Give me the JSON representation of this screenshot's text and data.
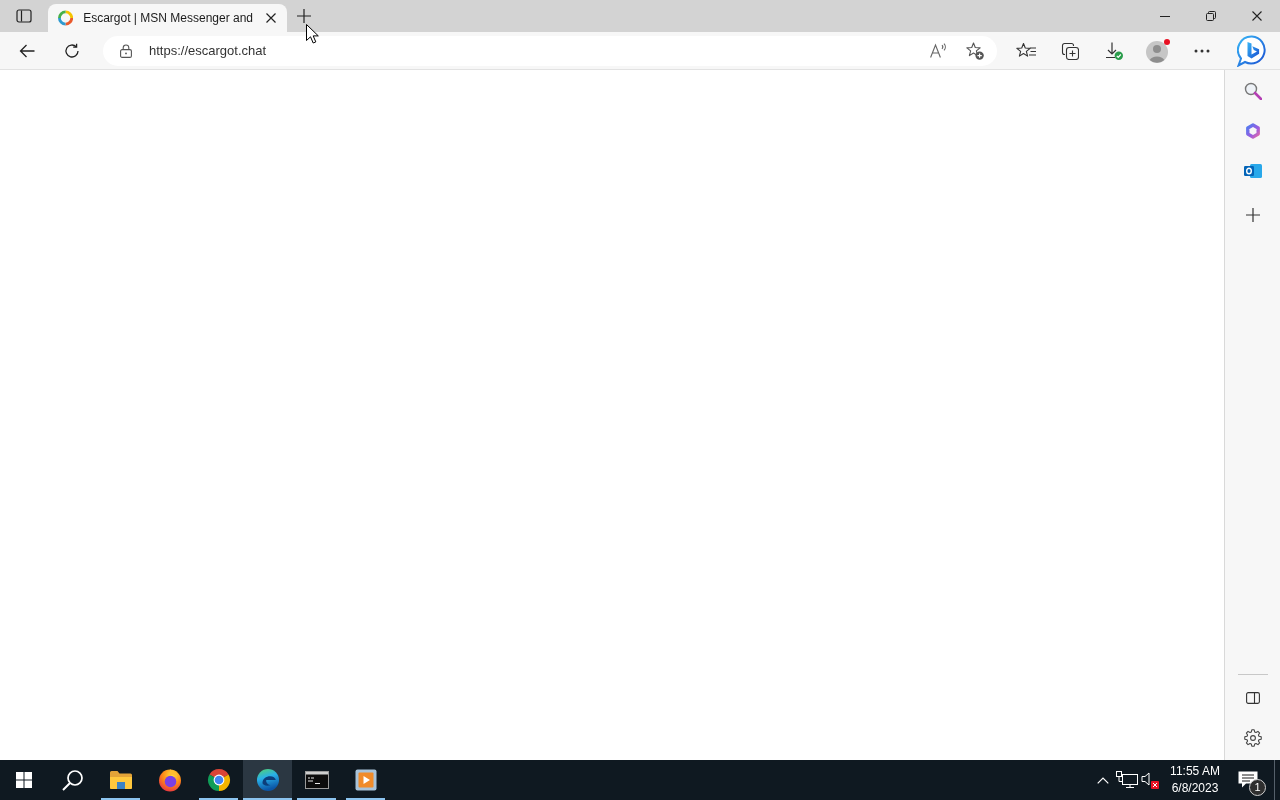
{
  "browser": {
    "tabs": [
      {
        "title": "Escargot | MSN Messenger and",
        "selected": true
      }
    ],
    "address_bar": {
      "url": "https://escargot.chat"
    }
  },
  "taskbar": {
    "apps": [
      {
        "kind": "explorer",
        "running": true,
        "selected": false
      },
      {
        "kind": "firefox",
        "running": false,
        "selected": false
      },
      {
        "kind": "chrome",
        "running": true,
        "selected": false
      },
      {
        "kind": "edge",
        "running": true,
        "selected": true
      },
      {
        "kind": "terminal",
        "running": true,
        "selected": false
      },
      {
        "kind": "player",
        "running": true,
        "selected": false
      }
    ],
    "clock": {
      "time": "11:55 AM",
      "date": "6/8/2023"
    },
    "notification_count": "1"
  }
}
